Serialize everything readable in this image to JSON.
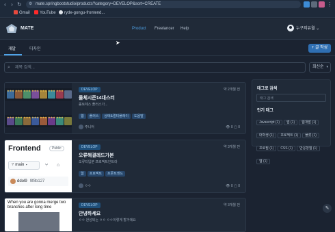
{
  "browser": {
    "url": "mate.springbootstudio/products?category=DEVELOP&sort=CREATE",
    "bookmarks": [
      "Gmail",
      "YouTube",
      "ryde-gongu-frontend..."
    ]
  },
  "header": {
    "logo": "MATE",
    "nav": [
      "Product",
      "Freelancer",
      "Help"
    ],
    "user": "누구지유월"
  },
  "tabs": [
    "개발",
    "디자인"
  ],
  "write_button": "+ 글 작성",
  "search": {
    "placeholder": "제목 검색...",
    "sort": "최신순"
  },
  "cards": [
    {
      "category": "DEVELOP",
      "date": "약 2개월 전",
      "title": "롤체시즌14대스터",
      "subtitle": "롤토체스 플러스가...",
      "tags": [
        "웹",
        "플러스",
        "상태&멀티플레이",
        "도움말"
      ],
      "author": "주니어",
      "views": "0",
      "comments": "0"
    },
    {
      "category": "DEVELOP",
      "date": "약 3개월 전",
      "title": "오류해결레드가본",
      "subtitle": "오류티입분 프로젝트인트라",
      "tags": [
        "웹",
        "프로젝트",
        "프론트엔드"
      ],
      "author": "ㅇㅇ",
      "views": "0",
      "comments": "0",
      "thumb": {
        "repo": "Frontend",
        "visibility": "Public",
        "branch": "main",
        "commit_user": "ddol9",
        "commit_hash": "9f8b127"
      }
    },
    {
      "category": "DEVELOP",
      "date": "약 3개월 전",
      "title": "안녕하세요",
      "subtitle": "ㅇㅇ 완성되는 ㅇㅇ ㅇㅇ이렇게 할거에요",
      "thumb": {
        "meme": "When you are gonna merge two branches after long time"
      }
    }
  ],
  "sidebar": {
    "tag_search_title": "태그로 검색",
    "tag_search_placeholder": "태그 검색",
    "popular_title": "인기 태그",
    "popular_tags": [
      "Javascript (1)",
      "앱 (1)",
      "웹개발 (1)",
      "대학생 (1)",
      "프로젝트 (1)",
      "플롯 (1)",
      "프로필 (1)",
      "CSS (1)",
      "반응형웹 (1)",
      "웹 (1)"
    ]
  },
  "colors": {
    "accent": "#4fa3e8",
    "background": "#1b2331",
    "card": "#202a38",
    "badge": "#1f4f7a"
  }
}
